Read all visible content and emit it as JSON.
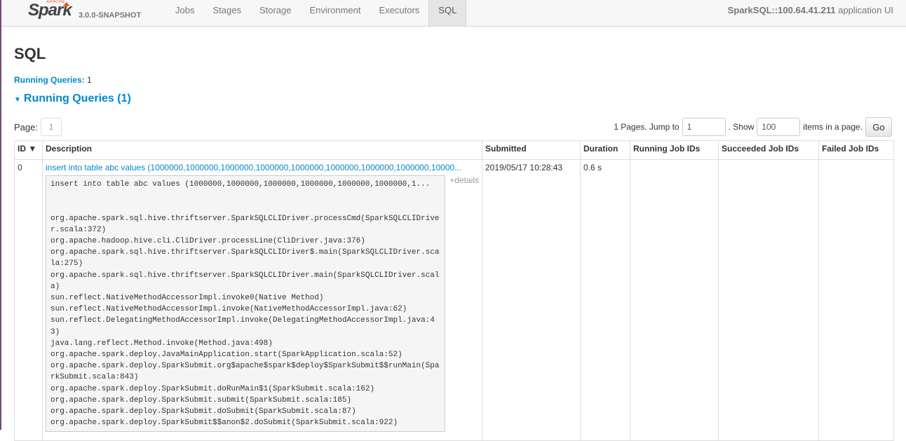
{
  "brand": {
    "apache": "APACHE",
    "logo": "Spark",
    "version": "3.0.0-SNAPSHOT"
  },
  "nav": {
    "tabs": [
      "Jobs",
      "Stages",
      "Storage",
      "Environment",
      "Executors",
      "SQL"
    ],
    "active": "SQL"
  },
  "app": {
    "name": "SparkSQL::100.64.41.211",
    "suffix": "application UI"
  },
  "page": {
    "title": "SQL"
  },
  "summary": {
    "label": "Running Queries:",
    "count": "1"
  },
  "section": {
    "title": "Running Queries (1)"
  },
  "pager": {
    "page_label": "Page:",
    "current_page": "1",
    "pages_text": "1 Pages. Jump to",
    "jump_value": "1",
    "show_text": ". Show",
    "show_value": "100",
    "items_text": "items in a page.",
    "go_label": "Go"
  },
  "table": {
    "headers": [
      "ID ▼",
      "Description",
      "Submitted",
      "Duration",
      "Running Job IDs",
      "Succeeded Job IDs",
      "Failed Job IDs"
    ],
    "row": {
      "id": "0",
      "description": "insert into table abc values (1000000,1000000,1000000,1000000,1000000,1000000,1000000,1000000,10000...",
      "details_label": "+details",
      "stack_first": "insert into table abc values (1000000,1000000,1000000,1000000,1000000,1000000,1...",
      "stack_body": "\n\norg.apache.spark.sql.hive.thriftserver.SparkSQLCLIDriver.processCmd(SparkSQLCLIDriver.scala:372)\norg.apache.hadoop.hive.cli.CliDriver.processLine(CliDriver.java:376)\norg.apache.spark.sql.hive.thriftserver.SparkSQLCLIDriver$.main(SparkSQLCLIDriver.scala:275)\norg.apache.spark.sql.hive.thriftserver.SparkSQLCLIDriver.main(SparkSQLCLIDriver.scala)\nsun.reflect.NativeMethodAccessorImpl.invoke0(Native Method)\nsun.reflect.NativeMethodAccessorImpl.invoke(NativeMethodAccessorImpl.java:62)\nsun.reflect.DelegatingMethodAccessorImpl.invoke(DelegatingMethodAccessorImpl.java:43)\njava.lang.reflect.Method.invoke(Method.java:498)\norg.apache.spark.deploy.JavaMainApplication.start(SparkApplication.scala:52)\norg.apache.spark.deploy.SparkSubmit.org$apache$spark$deploy$SparkSubmit$$runMain(SparkSubmit.scala:843)\norg.apache.spark.deploy.SparkSubmit.doRunMain$1(SparkSubmit.scala:162)\norg.apache.spark.deploy.SparkSubmit.submit(SparkSubmit.scala:185)\norg.apache.spark.deploy.SparkSubmit.doSubmit(SparkSubmit.scala:87)\norg.apache.spark.deploy.SparkSubmit$$anon$2.doSubmit(SparkSubmit.scala:922)",
      "submitted": "2019/05/17 10:28:43",
      "duration": "0.6 s",
      "running_jobs": "",
      "succeeded_jobs": "",
      "failed_jobs": ""
    }
  }
}
